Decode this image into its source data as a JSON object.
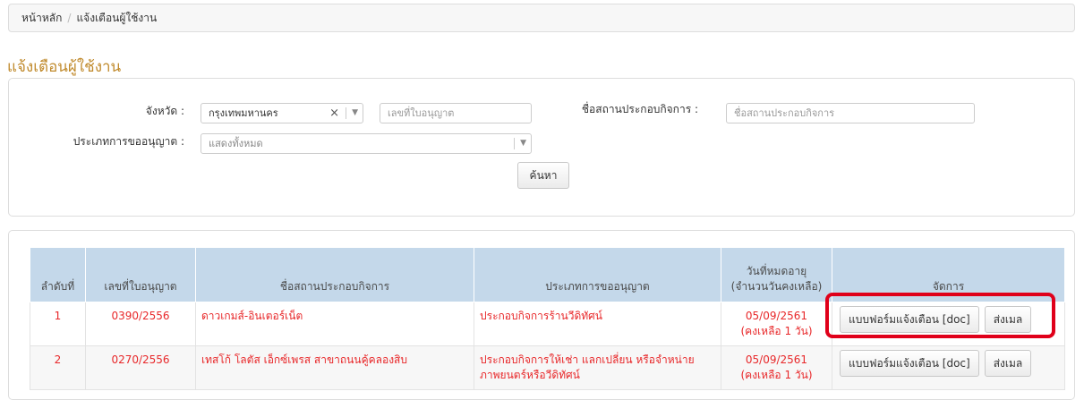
{
  "breadcrumb": {
    "home": "หน้าหลัก",
    "separator": "/",
    "current": "แจ้งเตือนผู้ใช้งาน"
  },
  "page_title": "แจ้งเตือนผู้ใช้งาน",
  "filters": {
    "province_label": "จังหวัด :",
    "province_value": "กรุงเทพมหานคร",
    "license_no_placeholder": "เลขที่ใบอนุญาต",
    "business_label": "ชื่อสถานประกอบกิจการ :",
    "business_placeholder": "ชื่อสถานประกอบกิจการ",
    "license_type_label": "ประเภทการขออนุญาต :",
    "license_type_value": "แสดงทั้งหมด",
    "search_button": "ค้นหา"
  },
  "table": {
    "headers": {
      "index": "ลำดับที่",
      "license_no": "เลขที่ใบอนุญาต",
      "business_name": "ชื่อสถานประกอบกิจการ",
      "license_type": "ประเภทการขออนุญาต",
      "expiry_line1": "วันที่หมดอายุ",
      "expiry_line2": "(จำนวนวันคงเหลือ)",
      "actions": "จัดการ"
    },
    "rows": [
      {
        "index": "1",
        "license_no": "0390/2556",
        "business_name": "ดาวเกมส์-อินเตอร์เน็ต",
        "license_type": "ประกอบกิจการร้านวีดิทัศน์",
        "expiry_date": "05/09/2561",
        "remaining": "(คงเหลือ 1 วัน)",
        "form_button": "แบบฟอร์มแจ้งเตือน [doc]",
        "email_button": "ส่งเมล"
      },
      {
        "index": "2",
        "license_no": "0270/2556",
        "business_name": "เทสโก้ โลตัส เอ็กซ์เพรส สาขาถนนคู้คลองสิบ",
        "license_type": "ประกอบกิจการให้เช่า แลกเปลี่ยน หรือจำหน่ายภาพยนตร์หรือวีดิทัศน์",
        "expiry_date": "05/09/2561",
        "remaining": "(คงเหลือ 1 วัน)",
        "form_button": "แบบฟอร์มแจ้งเตือน [doc]",
        "email_button": "ส่งเมล"
      }
    ]
  },
  "colors": {
    "title": "#c08a2c",
    "header_bg": "#c4d8ea",
    "row_text": "#e8282a",
    "highlight": "#e0001a"
  }
}
